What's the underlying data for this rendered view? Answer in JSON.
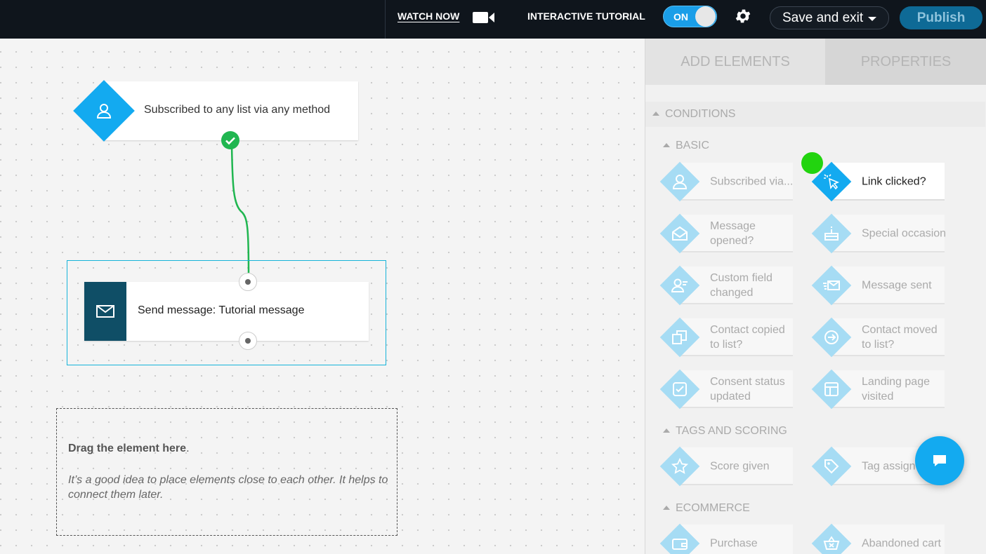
{
  "topbar": {
    "watch_now": "WATCH NOW",
    "tutorial_label": "INTERACTIVE TUTORIAL",
    "toggle_state": "ON",
    "save_exit": "Save and exit",
    "publish": "Publish"
  },
  "canvas": {
    "start_node": "Subscribed to any list via any method",
    "message_node": "Send message: Tutorial message",
    "drop_zone": {
      "title": "Drag the element here",
      "title_suffix": ".",
      "hint": "It’s a good idea to place elements close to each other. It helps to connect them later."
    }
  },
  "panel": {
    "tabs": {
      "add": "ADD ELEMENTS",
      "properties": "PROPERTIES"
    },
    "sections": {
      "conditions": "CONDITIONS",
      "basic": "BASIC",
      "tags": "TAGS AND SCORING",
      "ecommerce": "ECOMMERCE"
    },
    "items": {
      "subscribed_via": "Subscribed via...",
      "link_clicked": "Link clicked?",
      "message_opened": "Message opened?",
      "special_occasion": "Special occasion",
      "custom_field": "Custom field changed",
      "message_sent": "Message sent",
      "contact_copied": "Contact copied to list?",
      "contact_moved": "Contact moved to list?",
      "consent_status": "Consent status updated",
      "landing_page": "Landing page visited",
      "score_given": "Score given",
      "tag_assigned": "Tag assign",
      "purchase": "Purchase",
      "abandoned_cart": "Abandoned cart"
    }
  },
  "colors": {
    "accent": "#13aaf0",
    "topbar": "#0f151c",
    "message_node": "#0f4e66",
    "success": "#22c55e"
  }
}
